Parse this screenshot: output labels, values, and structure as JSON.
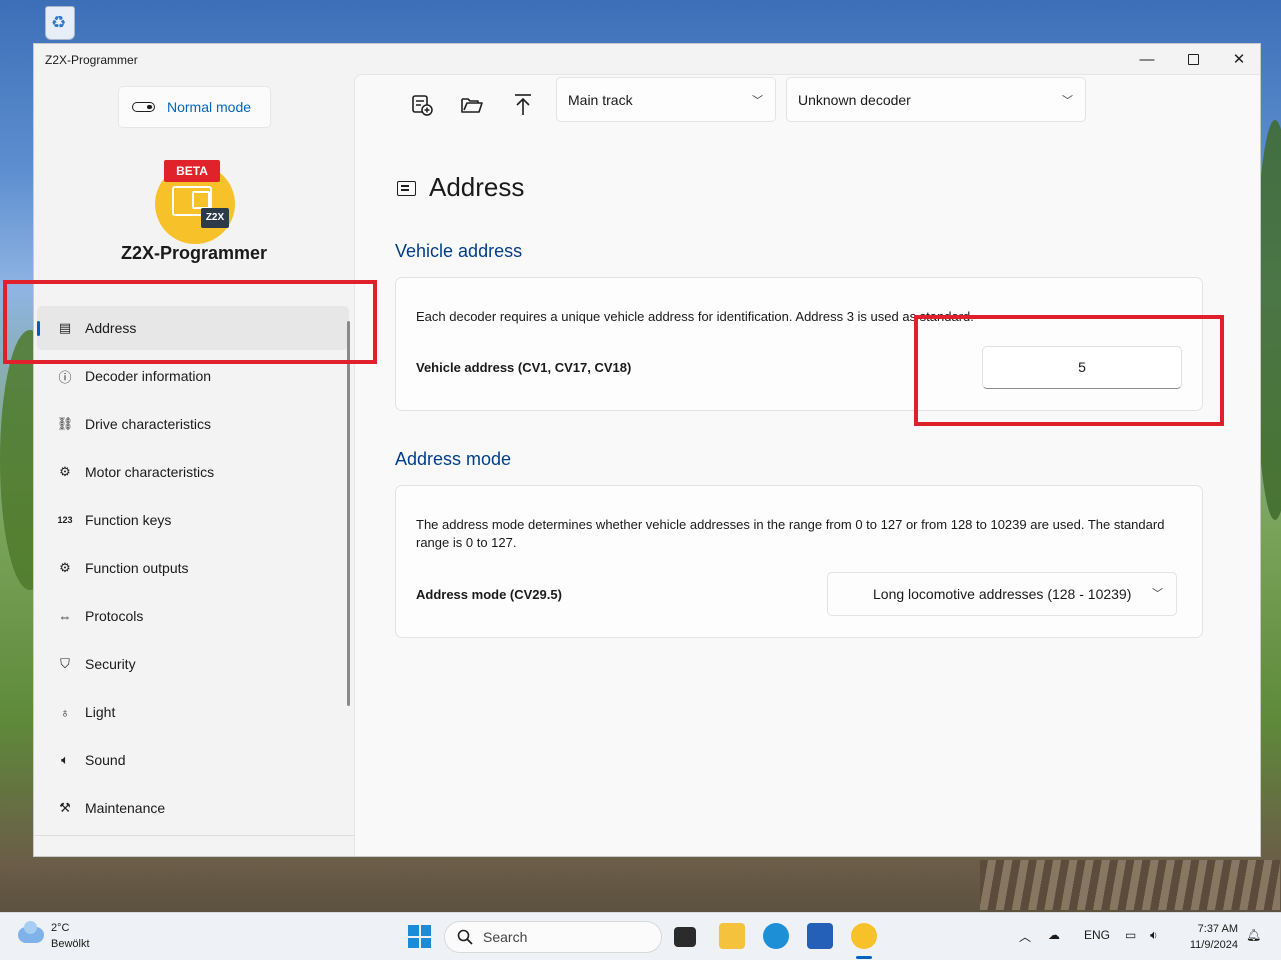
{
  "window": {
    "title": "Z2X-Programmer"
  },
  "sidebar": {
    "mode_label": "Normal mode",
    "logo": {
      "badge": "BETA",
      "mark": "Z2X"
    },
    "app_name": "Z2X-Programmer",
    "items": [
      {
        "label": "Address",
        "icon": "address-card-icon"
      },
      {
        "label": "Decoder information",
        "icon": "info-icon"
      },
      {
        "label": "Drive characteristics",
        "icon": "drive-icon"
      },
      {
        "label": "Motor characteristics",
        "icon": "motor-icon"
      },
      {
        "label": "Function keys",
        "icon": "function-keys-icon"
      },
      {
        "label": "Function outputs",
        "icon": "function-outputs-icon"
      },
      {
        "label": "Protocols",
        "icon": "protocols-icon"
      },
      {
        "label": "Security",
        "icon": "shield-icon"
      },
      {
        "label": "Light",
        "icon": "lightbulb-icon"
      },
      {
        "label": "Sound",
        "icon": "speaker-icon"
      },
      {
        "label": "Maintenance",
        "icon": "tools-icon"
      }
    ]
  },
  "toolbar": {
    "track": "Main track",
    "decoder": "Unknown decoder"
  },
  "page": {
    "title": "Address",
    "vehicle_section": {
      "title": "Vehicle address",
      "description": "Each decoder requires a unique vehicle address for identification. Address 3 is used as standard.",
      "field_label": "Vehicle address (CV1, CV17, CV18)",
      "value": "5"
    },
    "mode_section": {
      "title": "Address mode",
      "description": "The address mode determines whether vehicle addresses in the range from 0 to 127 or from 128 to 10239 are used. The standard range is 0 to 127.",
      "field_label": "Address mode (CV29.5)",
      "value": "Long locomotive addresses (128 - 10239)"
    }
  },
  "taskbar": {
    "temperature": "2°C",
    "weather": "Bewölkt",
    "search_placeholder": "Search",
    "language": "ENG",
    "time": "7:37 AM",
    "date": "11/9/2024"
  },
  "colors": {
    "accent": "#005fb8",
    "highlight": "#e0202a",
    "section_title": "#003e8a"
  }
}
